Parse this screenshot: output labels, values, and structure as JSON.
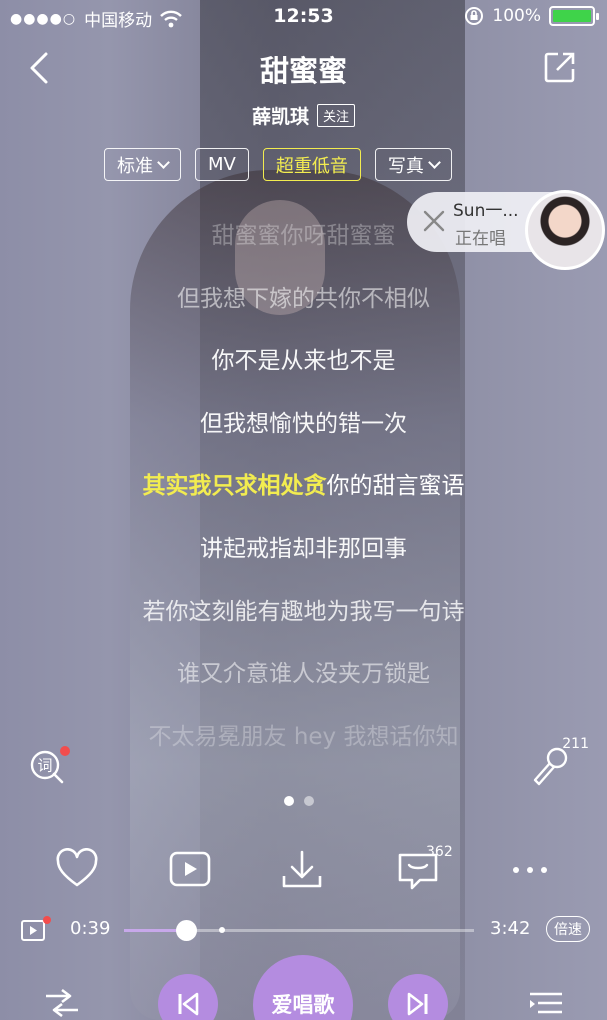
{
  "status_bar": {
    "signal_dots": "●●●●○",
    "carrier": "中国移动",
    "time": "12:53",
    "battery_percent": "100%",
    "battery_fill": 1.0
  },
  "header": {
    "title": "甜蜜蜜",
    "artist": "薛凯琪",
    "follow_label": "关注"
  },
  "tabs": [
    {
      "label": "标准",
      "dropdown": true,
      "active": false
    },
    {
      "label": "MV",
      "dropdown": false,
      "active": false
    },
    {
      "label": "超重低音",
      "dropdown": false,
      "active": true
    },
    {
      "label": "写真",
      "dropdown": true,
      "active": false
    }
  ],
  "now_singing": {
    "name": "Sun一...",
    "status": "正在唱"
  },
  "lyrics": [
    {
      "pre": "甜蜜蜜你呀甜蜜蜜",
      "hl": "",
      "post": "",
      "opacity": 0.3
    },
    {
      "pre": "但我想下嫁的共你不相似",
      "hl": "",
      "post": "",
      "opacity": 0.55
    },
    {
      "pre": "你不是从来也不是",
      "hl": "",
      "post": "",
      "opacity": 0.95
    },
    {
      "pre": "但我想愉快的错一次",
      "hl": "",
      "post": "",
      "opacity": 0.95
    },
    {
      "pre": "",
      "hl": "其实我只求相处贪",
      "post": "你的甜言蜜语",
      "opacity": 1
    },
    {
      "pre": "讲起戒指却非那回事",
      "hl": "",
      "post": "",
      "opacity": 0.95
    },
    {
      "pre": "若你这刻能有趣地为我写一句诗",
      "hl": "",
      "post": "",
      "opacity": 0.8
    },
    {
      "pre": "谁又介意谁人没夹万锁匙",
      "hl": "",
      "post": "",
      "opacity": 0.55
    },
    {
      "pre": "不太易冕朋友 hey 我想话你知",
      "hl": "",
      "post": "",
      "opacity": 0.28
    }
  ],
  "side_buttons": {
    "lyrics_icon_char": "词",
    "mic_count": "211"
  },
  "actions": {
    "comments_count": "362"
  },
  "playback": {
    "current_time": "0:39",
    "total_time": "3:42",
    "progress": 0.176,
    "buffered": 0.28,
    "speed_label": "倍速"
  },
  "controls": {
    "center_label": "爱唱歌"
  },
  "colors": {
    "accent_yellow": "#f2ec50",
    "accent_purple": "#b48ce0",
    "progress_purple": "#c7a8ea",
    "badge_red": "#f24d4d"
  },
  "icons": [
    "back-icon",
    "share-icon",
    "close-icon",
    "lyrics-search-icon",
    "microphone-icon",
    "heart-icon",
    "video-icon",
    "download-icon",
    "comment-icon",
    "more-icon",
    "mini-video-icon",
    "shuffle-icon",
    "previous-icon",
    "next-icon",
    "playlist-icon"
  ]
}
